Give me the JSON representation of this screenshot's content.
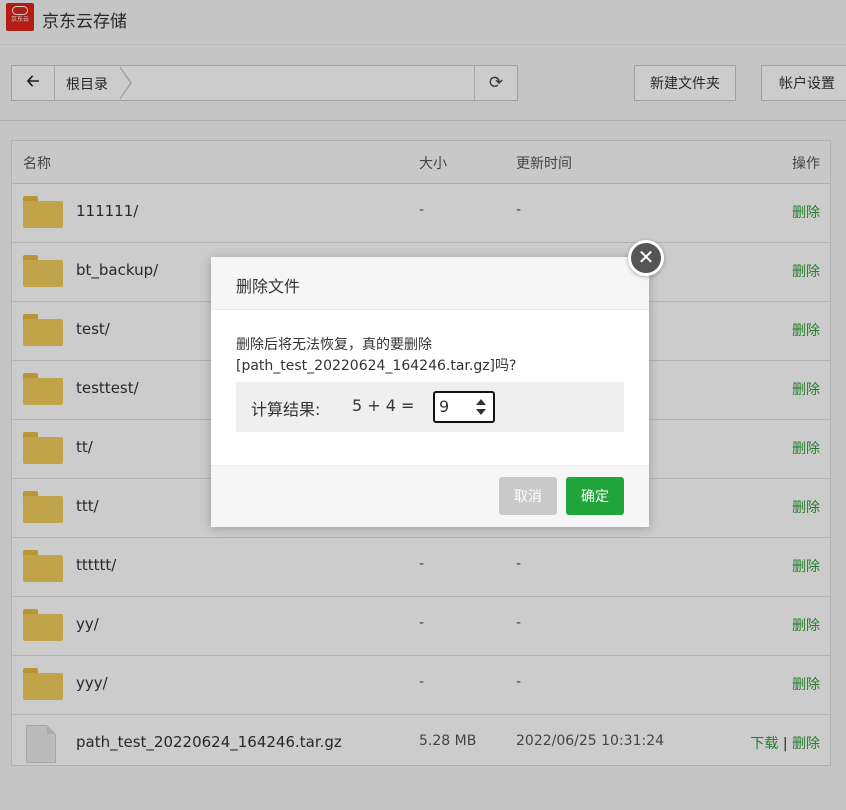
{
  "header": {
    "title": "京东云存储",
    "logo_text": "京东云"
  },
  "toolbar": {
    "breadcrumb": "根目录",
    "new_folder_label": "新建文件夹",
    "account_settings_label": "帐户设置"
  },
  "table": {
    "columns": {
      "name": "名称",
      "size": "大小",
      "time": "更新时间",
      "action": "操作"
    },
    "rows": [
      {
        "type": "folder",
        "name": "111111/",
        "size": "-",
        "time": "-",
        "actions": [
          "删除"
        ]
      },
      {
        "type": "folder",
        "name": "bt_backup/",
        "size": "",
        "time": "",
        "actions": [
          "删除"
        ]
      },
      {
        "type": "folder",
        "name": "test/",
        "size": "",
        "time": "",
        "actions": [
          "删除"
        ]
      },
      {
        "type": "folder",
        "name": "testtest/",
        "size": "",
        "time": "",
        "actions": [
          "删除"
        ]
      },
      {
        "type": "folder",
        "name": "tt/",
        "size": "",
        "time": "",
        "actions": [
          "删除"
        ]
      },
      {
        "type": "folder",
        "name": "ttt/",
        "size": "",
        "time": "",
        "actions": [
          "删除"
        ]
      },
      {
        "type": "folder",
        "name": "tttttt/",
        "size": "-",
        "time": "-",
        "actions": [
          "删除"
        ]
      },
      {
        "type": "folder",
        "name": "yy/",
        "size": "-",
        "time": "-",
        "actions": [
          "删除"
        ]
      },
      {
        "type": "folder",
        "name": "yyy/",
        "size": "-",
        "time": "-",
        "actions": [
          "删除"
        ]
      },
      {
        "type": "file",
        "name": "path_test_20220624_164246.tar.gz",
        "size": "5.28 MB",
        "time": "2022/06/25 10:31:24",
        "actions": [
          "下载",
          "删除"
        ]
      }
    ]
  },
  "modal": {
    "title": "删除文件",
    "message_line1": "删除后将无法恢复，真的要删除",
    "message_line2": "[path_test_20220624_164246.tar.gz]吗?",
    "calc_label": "计算结果:",
    "calc_expr": "5 + 4  =",
    "calc_value": "9",
    "cancel_label": "取消",
    "confirm_label": "确定"
  },
  "colors": {
    "accent_green": "#20a53a",
    "link_green": "#2f9d3a",
    "folder": "#f2cc5c",
    "logo_red": "#e1251b"
  }
}
